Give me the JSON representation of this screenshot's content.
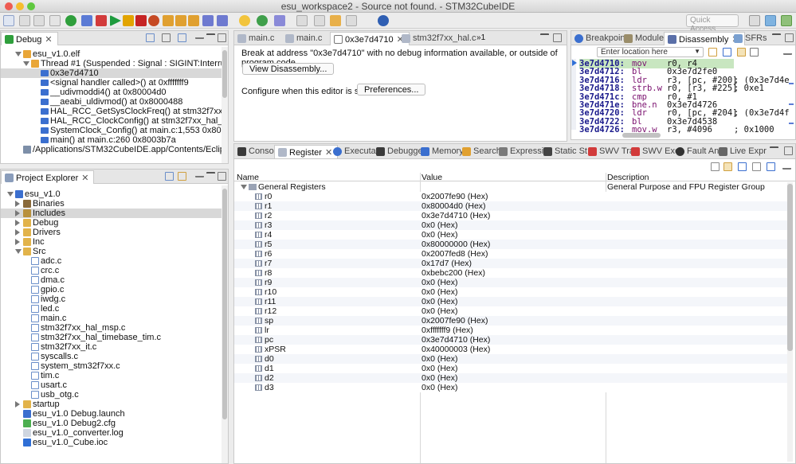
{
  "window": {
    "title": "esu_workspace2 - Source not found. - STM32CubeIDE"
  },
  "toolbar": {
    "quick_access_placeholder": "Quick Access"
  },
  "debug_view": {
    "tab": "Debug",
    "rows": [
      {
        "label": "esu_v1.0.elf",
        "icon": "elf-icon"
      },
      {
        "label": "Thread #1 (Suspended : Signal : SIGINT:Interrupt)",
        "icon": "thread-icon"
      },
      {
        "label": "0x3e7d4710",
        "icon": "stack-frame-icon"
      },
      {
        "label": "<signal handler called>() at 0xfffffff9",
        "icon": "stack-frame-icon"
      },
      {
        "label": "__udivmoddi4() at 0x80004d0",
        "icon": "stack-frame-icon"
      },
      {
        "label": "__aeabi_uldivmod() at 0x8000488",
        "icon": "stack-frame-icon"
      },
      {
        "label": "HAL_RCC_GetSysClockFreq() at stm32f7xx_hal_rcc.c:1,00",
        "icon": "stack-frame-icon"
      },
      {
        "label": "HAL_RCC_ClockConfig() at stm32f7xx_hal_rcc.c:831 0x8(",
        "icon": "stack-frame-icon"
      },
      {
        "label": "SystemClock_Config() at main.c:1,553 0x8003adc",
        "icon": "stack-frame-icon"
      },
      {
        "label": "main() at main.c:260 0x8003b7a",
        "icon": "stack-frame-icon"
      },
      {
        "label": "/Applications/STM32CubeIDE.app/Contents/Eclipse/plugins/com",
        "icon": "process-icon"
      }
    ]
  },
  "project_explorer": {
    "tab": "Project Explorer",
    "items": [
      {
        "label": "esu_v1.0",
        "level": 0,
        "kind": "project"
      },
      {
        "label": "Binaries",
        "level": 1,
        "kind": "binaries"
      },
      {
        "label": "Includes",
        "level": 1,
        "kind": "includes"
      },
      {
        "label": "Debug",
        "level": 1,
        "kind": "folder"
      },
      {
        "label": "Drivers",
        "level": 1,
        "kind": "folder"
      },
      {
        "label": "Inc",
        "level": 1,
        "kind": "folder"
      },
      {
        "label": "Src",
        "level": 1,
        "kind": "folder-open"
      },
      {
        "label": "adc.c",
        "level": 2,
        "kind": "c-file"
      },
      {
        "label": "crc.c",
        "level": 2,
        "kind": "c-file"
      },
      {
        "label": "dma.c",
        "level": 2,
        "kind": "c-file"
      },
      {
        "label": "gpio.c",
        "level": 2,
        "kind": "c-file"
      },
      {
        "label": "iwdg.c",
        "level": 2,
        "kind": "c-file"
      },
      {
        "label": "led.c",
        "level": 2,
        "kind": "c-file"
      },
      {
        "label": "main.c",
        "level": 2,
        "kind": "c-file"
      },
      {
        "label": "stm32f7xx_hal_msp.c",
        "level": 2,
        "kind": "c-file"
      },
      {
        "label": "stm32f7xx_hal_timebase_tim.c",
        "level": 2,
        "kind": "c-file"
      },
      {
        "label": "stm32f7xx_it.c",
        "level": 2,
        "kind": "c-file"
      },
      {
        "label": "syscalls.c",
        "level": 2,
        "kind": "c-file"
      },
      {
        "label": "system_stm32f7xx.c",
        "level": 2,
        "kind": "c-file"
      },
      {
        "label": "tim.c",
        "level": 2,
        "kind": "c-file"
      },
      {
        "label": "usart.c",
        "level": 2,
        "kind": "c-file"
      },
      {
        "label": "usb_otg.c",
        "level": 2,
        "kind": "c-file"
      },
      {
        "label": "startup",
        "level": 1,
        "kind": "folder"
      },
      {
        "label": "esu_v1.0 Debug.launch",
        "level": 1,
        "kind": "launch-file"
      },
      {
        "label": "esu_v1.0 Debug2.cfg",
        "level": 1,
        "kind": "cfg-file"
      },
      {
        "label": "esu_v1.0_converter.log",
        "level": 1,
        "kind": "log-file"
      },
      {
        "label": "esu_v1.0_Cube.ioc",
        "level": 1,
        "kind": "ioc-file"
      }
    ]
  },
  "editor": {
    "tabs": [
      "main.c",
      "main.c",
      "0x3e7d4710",
      "stm32f7xx_hal.c"
    ],
    "overflow_count": "1",
    "message": "Break at address \"0x3e7d4710\" with no debug information available, or outside of program code.",
    "view_disassembly_button": "View Disassembly...",
    "configure_label": "Configure when this editor is shown",
    "preferences_button": "Preferences..."
  },
  "disassembly_view": {
    "tabs": [
      "Breakpoints",
      "Modules",
      "Disassembly",
      "SFRs"
    ],
    "location_placeholder": "Enter location here",
    "lines": [
      {
        "addr": "3e7d4710:",
        "op": "mov",
        "args": "r0, r4",
        "comment": ""
      },
      {
        "addr": "3e7d4712:",
        "op": "bl",
        "args": "0x3e7d2fe0",
        "comment": ""
      },
      {
        "addr": "3e7d4716:",
        "op": "ldr",
        "args": "r3, [pc, #200]",
        "comment": "; (0x3e7d4e"
      },
      {
        "addr": "3e7d4718:",
        "op": "strb.w",
        "args": "r0, [r3, #225]",
        "comment": "; 0xe1"
      },
      {
        "addr": "3e7d471c:",
        "op": "cmp",
        "args": "r0, #1",
        "comment": ""
      },
      {
        "addr": "3e7d471e:",
        "op": "bne.n",
        "args": "0x3e7d4726",
        "comment": ""
      },
      {
        "addr": "3e7d4720:",
        "op": "ldr",
        "args": "r0, [pc, #204]",
        "comment": "; (0x3e7d4f"
      },
      {
        "addr": "3e7d4722:",
        "op": "bl",
        "args": "0x3e7d4538",
        "comment": ""
      },
      {
        "addr": "3e7d4726:",
        "op": "mov.w",
        "args": "r3, #4096",
        "comment": "; 0x1000"
      }
    ]
  },
  "bottom_view": {
    "tabs": [
      "Console",
      "Register",
      "Executa",
      "Debugge",
      "Memory",
      "Search",
      "Expressi",
      "Static St",
      "SWV Tra",
      "SWV Exc",
      "Fault An",
      "Live Expr"
    ],
    "columns": {
      "name": "Name",
      "value": "Value",
      "description": "Description"
    },
    "group": {
      "name": "General Registers",
      "description": "General Purpose and FPU Register Group"
    },
    "registers": [
      {
        "name": "r0",
        "value": "0x2007fe90 (Hex)"
      },
      {
        "name": "r1",
        "value": "0x80004d0 (Hex)"
      },
      {
        "name": "r2",
        "value": "0x3e7d4710 (Hex)"
      },
      {
        "name": "r3",
        "value": "0x0 (Hex)"
      },
      {
        "name": "r4",
        "value": "0x0 (Hex)"
      },
      {
        "name": "r5",
        "value": "0x80000000 (Hex)"
      },
      {
        "name": "r6",
        "value": "0x2007fed8 (Hex)"
      },
      {
        "name": "r7",
        "value": "0x17d7 (Hex)"
      },
      {
        "name": "r8",
        "value": "0xbebc200 (Hex)"
      },
      {
        "name": "r9",
        "value": "0x0 (Hex)"
      },
      {
        "name": "r10",
        "value": "0x0 (Hex)"
      },
      {
        "name": "r11",
        "value": "0x0 (Hex)"
      },
      {
        "name": "r12",
        "value": "0x0 (Hex)"
      },
      {
        "name": "sp",
        "value": "0x2007fe90 (Hex)"
      },
      {
        "name": "lr",
        "value": "0xfffffff9 (Hex)"
      },
      {
        "name": "pc",
        "value": "0x3e7d4710 (Hex)"
      },
      {
        "name": "xPSR",
        "value": "0x40000003 (Hex)"
      },
      {
        "name": "d0",
        "value": "0x0 (Hex)"
      },
      {
        "name": "d1",
        "value": "0x0 (Hex)"
      },
      {
        "name": "d2",
        "value": "0x0 (Hex)"
      },
      {
        "name": "d3",
        "value": "0x0 (Hex)"
      }
    ]
  },
  "colors": {
    "selection": "#d8d8d8",
    "address": "#1a1a8c",
    "opcode": "#7a0f6e",
    "accent": "#3b6fcf"
  }
}
